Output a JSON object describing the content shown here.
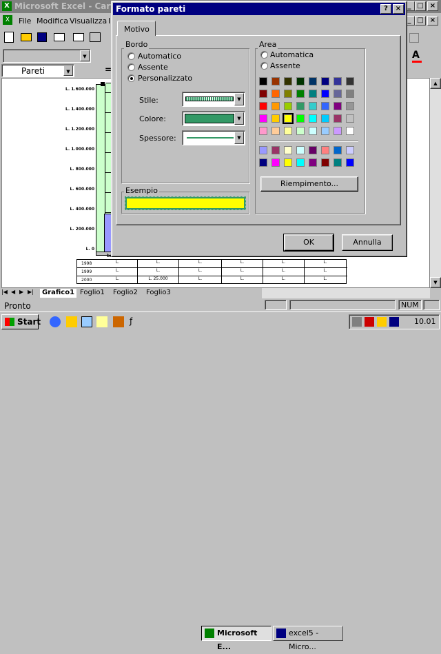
{
  "excel": {
    "title": "Microsoft Excel - Cartel2",
    "menu": [
      "File",
      "Modifica",
      "Visualizza",
      "I"
    ],
    "name_box": "Pareti",
    "y_ticks": [
      "L. 1.600.000",
      "L. 1.400.000",
      "L. 1.200.000",
      "L. 1.000.000",
      "L. 800.000",
      "L. 600.000",
      "L. 400.000",
      "L. 200.000",
      "L. 0"
    ],
    "x_label": "be",
    "table_rows": [
      {
        "year": "1998",
        "cells": [
          "L.",
          "L.",
          "L.",
          "L.",
          "L.",
          "L."
        ]
      },
      {
        "year": "1999",
        "cells": [
          "L.",
          "L.",
          "L.",
          "L.",
          "L.",
          "L."
        ]
      },
      {
        "year": "2000",
        "cells": [
          "L.",
          "L. 25.000",
          "L.",
          "L.",
          "L.",
          "L."
        ]
      }
    ],
    "sheet_tabs": [
      "Grafico1",
      "Foglio1",
      "Foglio2",
      "Foglio3"
    ],
    "status": "Pronto",
    "num": "NUM"
  },
  "dialog": {
    "title": "Formato pareti",
    "tab": "Motivo",
    "bordo": {
      "label": "Bordo",
      "options": [
        "Automatico",
        "Assente",
        "Personalizzato"
      ],
      "selected": 2,
      "stile_label": "Stile:",
      "colore_label": "Colore:",
      "spessore_label": "Spessore:",
      "colore_value": "#339966"
    },
    "area": {
      "label": "Area",
      "options": [
        "Automatica",
        "Assente"
      ],
      "palette": [
        [
          "#000000",
          "#993300",
          "#333300",
          "#003300",
          "#003366",
          "#000080",
          "#333399",
          "#333333"
        ],
        [
          "#800000",
          "#FF6600",
          "#808000",
          "#008000",
          "#008080",
          "#0000FF",
          "#666699",
          "#808080"
        ],
        [
          "#FF0000",
          "#FF9900",
          "#99CC00",
          "#339966",
          "#33CCCC",
          "#3366FF",
          "#800080",
          "#969696"
        ],
        [
          "#FF00FF",
          "#FFCC00",
          "#FFFF00",
          "#00FF00",
          "#00FFFF",
          "#00CCFF",
          "#993366",
          "#C0C0C0"
        ],
        [
          "#FF99CC",
          "#FFCC99",
          "#FFFF99",
          "#CCFFCC",
          "#CCFFFF",
          "#99CCFF",
          "#CC99FF",
          "#FFFFFF"
        ]
      ],
      "palette2": [
        [
          "#9999FF",
          "#993366",
          "#FFFFCC",
          "#CCFFFF",
          "#660066",
          "#FF8080",
          "#0066CC",
          "#CCCCFF"
        ],
        [
          "#000080",
          "#FF00FF",
          "#FFFF00",
          "#00FFFF",
          "#800080",
          "#800000",
          "#008080",
          "#0000FF"
        ]
      ],
      "fill_button": "Riempimento..."
    },
    "esempio_label": "Esempio",
    "esempio_fill": "#FFFF00",
    "ok": "OK",
    "annulla": "Annulla"
  },
  "taskbar": {
    "start": "Start",
    "tasks": [
      "Microsoft E...",
      "excel5 - Micro..."
    ],
    "clock": "10.01"
  }
}
